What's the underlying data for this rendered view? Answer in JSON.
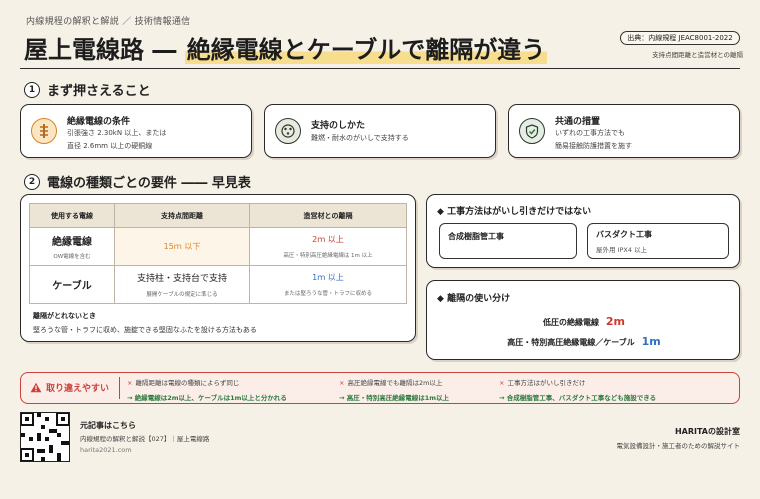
{
  "header": {
    "kicker": "内線規程の解釈と解説 ／ 技術情報通信",
    "title_prefix": "屋上電線路 ― ",
    "title_highlight": "絶縁電線とケーブルで離隔が違う",
    "source": "出典：内線規程 JEAC8001-2022",
    "source_sub": "支持点間距離と造営材との離隔"
  },
  "section1": {
    "number": "1",
    "title": "まず押さえること",
    "cards": [
      {
        "icon": "insulated-wire-icon",
        "title": "絶縁電線の条件",
        "line1": "引張強さ 2.30kN 以上、または",
        "line2": "直径 2.6mm 以上の硬銅線"
      },
      {
        "icon": "insulator-support-icon",
        "title": "支持のしかた",
        "line1": "難燃・耐水のがいしで支持する",
        "line2": ""
      },
      {
        "icon": "shield-check-icon",
        "title": "共通の措置",
        "line1": "いずれの工事方法でも",
        "line2": "簡易接触防護措置を施す"
      }
    ]
  },
  "section2": {
    "number": "2",
    "title": "電線の種類ごとの要件 ―― 早見表",
    "table": {
      "headers": [
        "使用する電線",
        "支持点間距離",
        "造営材との離隔"
      ],
      "rows": [
        {
          "wire": "絶縁電線",
          "wire_sub": "OW電線を含む",
          "support": "15ｍ 以下",
          "clear_main": "2ｍ 以上",
          "clear_sub": "高圧・特別高圧絶縁電線は 1m 以上"
        },
        {
          "wire": "ケーブル",
          "wire_sub": "",
          "support": "支持柱・支持台で支持",
          "support_sub": "展開ケーブルの規定に準じる",
          "clear_main": "1ｍ 以上",
          "clear_sub": "または堅ろうな管・トラフに収める"
        }
      ]
    },
    "note_title": "離隔がとれないとき",
    "note_text": "堅ろうな管・トラフに収め、施錠できる堅固なふたを設ける方法もある"
  },
  "panel_methods": {
    "title": "工事方法はがいし引きだけではない",
    "items": [
      {
        "title": "合成樹脂管工事",
        "sub": ""
      },
      {
        "title": "バスダクト工事",
        "sub": "屋外用 IPX4 以上"
      }
    ]
  },
  "panel_clearance": {
    "title": "離隔の使い分け",
    "row1_label": "低圧の絶縁電線",
    "row1_value": "2m",
    "row2_label": "高圧・特別高圧絶縁電線／ケーブル",
    "row2_value": "1m"
  },
  "mistakes": {
    "label": "取り違えやすい",
    "items": [
      {
        "wrong": "離隔距離は電線の種類によらず同じ",
        "fix": "→ 絶縁電線は2m以上、ケーブルは1m以上と分かれる"
      },
      {
        "wrong": "高圧絶縁電線でも離隔は2m以上",
        "fix": "→ 高圧・特別高圧絶縁電線は1m以上"
      },
      {
        "wrong": "工事方法はがいし引きだけ",
        "fix": "→ 合成樹脂管工事、バスダクト工事なども施設できる"
      }
    ]
  },
  "footer": {
    "origin_title": "元記事はこちら",
    "origin_text": "内線規程の解釈と解説【027】｜屋上電線路",
    "origin_url": "harita2021.com",
    "brand": "HARITAの設計室",
    "brand_sub": "電気設備設計・施工者のための解説サイト"
  },
  "colors": {
    "accent_yellow": "#f7dd8e",
    "background": "#f6f1e6",
    "orange": "#d9832a",
    "red": "#d0392b",
    "blue": "#2f6fc4",
    "warning_red": "#c9413a",
    "fix_green": "#2b7a3d"
  }
}
